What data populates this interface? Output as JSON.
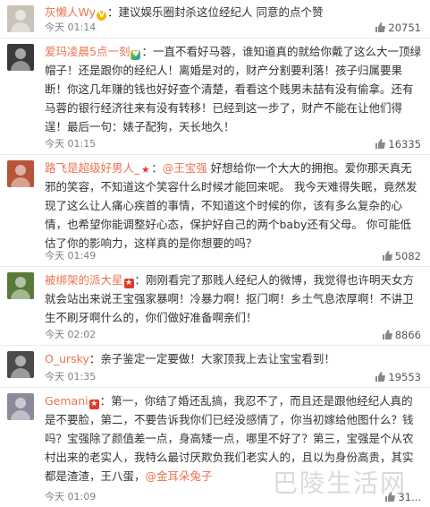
{
  "comments": [
    {
      "user": "灰懒人Wy",
      "badge": "v",
      "text": "：建议娱乐圈封杀这位经纪人 同意的点个赞",
      "time": "今天 01:14",
      "likes": "20751",
      "avatar_color": "#c9c2b8"
    },
    {
      "user": "爱玛凌晨5点一刻",
      "badge": "heart",
      "text": "：一直不看好马蓉，谁知道真的就给你戴了这么大一顶绿帽子！还是跟你的经纪人！离婚是对的，财产分割要利落！孩子归属要果断！你这几年赚的钱也好好查个清楚，看看这个贱男未喆有没有偷拿。还有马蓉的银行经济往来有没有转移！已经到这一步了，财产不能在让他们得逞！最后一句：婊子配狗，天长地久！",
      "time": "今天 01:15",
      "likes": "16335",
      "avatar_color": "#3a3a3a"
    },
    {
      "user": "路飞是超级好男人_",
      "badge": "star",
      "mention": "@王宝强",
      "text": " 好想给你一个大大的拥抱。爱你那天真无邪的笑容，不知道这个笑容什么时候才能回来呢。 我今天难得失眠，竟然发现了这么让人痛心疾首的事情，不知道这个时候的你，该有多么复杂的心情，也希望你能调整好心态，保护好自己的两个baby还有父母。 你可能低估了你的影响力，这样真的是你想要的吗？",
      "time": "今天 01:49",
      "likes": "5082",
      "avatar_color": "#b8543a"
    },
    {
      "user": "被绑架的派大星",
      "badge": "flag",
      "text": "：刚刚看完了那贱人经纪人的微博，我觉得也许明天女方就会站出来说王宝强家暴啊！冷暴力啊！抠门啊！乡土气息浓厚啊！不讲卫生不刷牙啊什么的，你们做好准备啊亲们！",
      "time": "今天 02:02",
      "likes": "8866",
      "avatar_color": "#5a7a3a"
    },
    {
      "user": "O_ursky",
      "badge": "",
      "text": "：亲子鉴定一定要做！大家顶我上去让宝宝看到！",
      "time": "今天 01:35",
      "likes": "19553",
      "avatar_color": "#4a4a4a"
    },
    {
      "user": "Gemani",
      "badge": "flag",
      "text": "：第一，你结了婚还乱搞，我忍不了，而且还是跟他经纪人真的是不要脸，第二，不要告诉我你们已经没感情了，你当初嫁给他图什么？钱吗？宝强除了颜值差一点，身高矮一点，哪里不好了？第三，宝强是个从农村出来的老实人，我特么最讨厌欺负我们老实人的，且以为身份高贵，其实都是渣渣，王八蛋",
      "mention_end": "@金耳朵兔子",
      "time": "今天 01:09",
      "likes": "31...",
      "avatar_color": "#8a8a9a"
    }
  ],
  "watermark": "巴陵生活网",
  "colors": {
    "username": "#eb7350",
    "meta": "#808080"
  }
}
